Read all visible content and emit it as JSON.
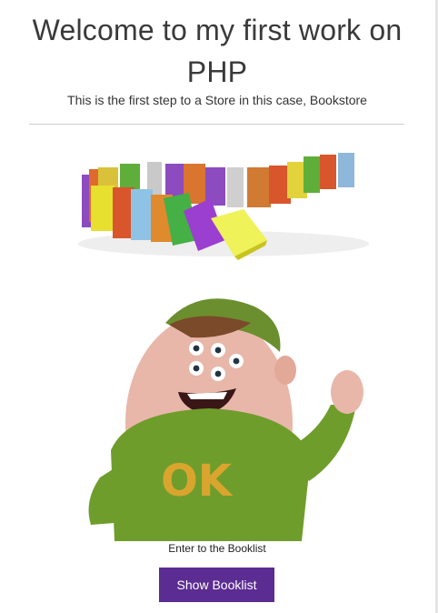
{
  "header": {
    "title": "Welcome to my first work on PHP",
    "subtitle": "This is the first step to a Store in this case, Bookstore"
  },
  "images": {
    "books": "books-illustration",
    "monster": "monster-character-illustration",
    "sweater_text": "OK"
  },
  "content": {
    "caption": "Enter to the Booklist",
    "button_label": "Show Booklist"
  },
  "colors": {
    "button": "#5b2c91",
    "sweater": "#6f9d2c",
    "cap": "#6b8f2e"
  }
}
